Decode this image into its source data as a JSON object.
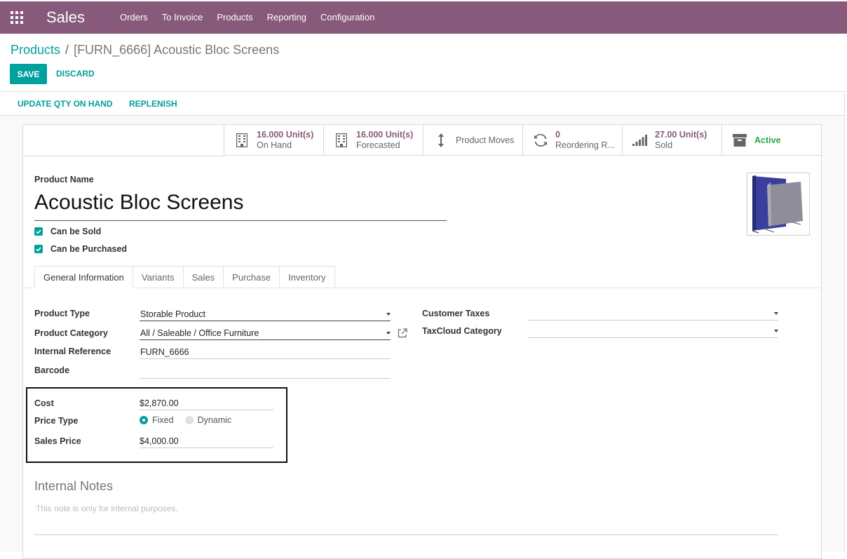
{
  "navbar": {
    "app_title": "Sales",
    "menu": [
      "Orders",
      "To Invoice",
      "Products",
      "Reporting",
      "Configuration"
    ]
  },
  "breadcrumb": {
    "parent": "Products",
    "separator": "/",
    "current": "[FURN_6666] Acoustic Bloc Screens"
  },
  "actions": {
    "save": "SAVE",
    "discard": "DISCARD"
  },
  "statusbar": {
    "update_qty": "UPDATE QTY ON HAND",
    "replenish": "REPLENISH"
  },
  "smart_buttons": {
    "on_hand": {
      "value": "16.000 Unit(s)",
      "label": "On Hand"
    },
    "forecasted": {
      "value": "16.000 Unit(s)",
      "label": "Forecasted"
    },
    "moves": {
      "label": "Product Moves"
    },
    "reordering": {
      "value": "0",
      "label": "Reordering R..."
    },
    "sold": {
      "value": "27.00 Unit(s)",
      "label": "Sold"
    },
    "active": {
      "label": "Active"
    }
  },
  "product": {
    "name_label": "Product Name",
    "name": "Acoustic Bloc Screens",
    "can_be_sold": "Can be Sold",
    "can_be_purchased": "Can be Purchased"
  },
  "tabs": [
    "General Information",
    "Variants",
    "Sales",
    "Purchase",
    "Inventory"
  ],
  "general": {
    "product_type_label": "Product Type",
    "product_type": "Storable Product",
    "category_label": "Product Category",
    "category": "All / Saleable / Office Furniture",
    "internal_ref_label": "Internal Reference",
    "internal_ref": "FURN_6666",
    "barcode_label": "Barcode",
    "barcode": "",
    "customer_taxes_label": "Customer Taxes",
    "taxcloud_label": "TaxCloud Category",
    "cost_label": "Cost",
    "cost_currency": "$",
    "cost": "2,870.00",
    "price_type_label": "Price Type",
    "price_fixed": "Fixed",
    "price_dynamic": "Dynamic",
    "sales_price_label": "Sales Price",
    "sales_currency": "$",
    "sales_price": "4,000.00"
  },
  "notes": {
    "title": "Internal Notes",
    "placeholder": "This note is only for internal purposes."
  },
  "colors": {
    "brand": "#875a7b",
    "accent": "#00a09d",
    "active": "#28a745"
  }
}
